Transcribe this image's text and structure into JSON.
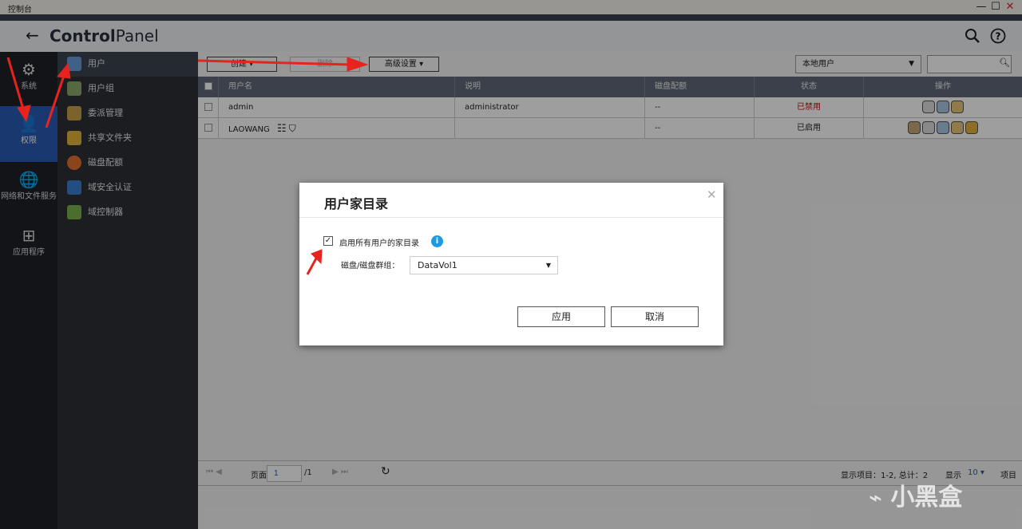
{
  "window": {
    "title": "控制台",
    "minimize": "—",
    "maximize": "☐",
    "close": "✕"
  },
  "header": {
    "back": "←",
    "title_bold": "Control",
    "title_rest": "Panel",
    "search_icon": "search-icon",
    "help_icon": "help-icon"
  },
  "iconnav": [
    {
      "label": "系统",
      "icon": "⚙"
    },
    {
      "label": "权限",
      "icon": "👤"
    },
    {
      "label": "网络和文件服务",
      "icon": "🌐"
    },
    {
      "label": "应用程序",
      "icon": "⊞"
    }
  ],
  "sidebar": [
    {
      "label": "用户",
      "color": "#6a9bd8"
    },
    {
      "label": "用户组",
      "color": "#8aa86a"
    },
    {
      "label": "委派管理",
      "color": "#c9a04a"
    },
    {
      "label": "共享文件夹",
      "color": "#e3b23c"
    },
    {
      "label": "磁盘配额",
      "color": "#e07030"
    },
    {
      "label": "域安全认证",
      "color": "#3b7fd0"
    },
    {
      "label": "域控制器",
      "color": "#7ab04a"
    }
  ],
  "toolbar": {
    "create": "创建",
    "delete": "删除",
    "advanced": "高级设置",
    "user_filter": "本地用户",
    "search_placeholder": ""
  },
  "table": {
    "columns": [
      "用户名",
      "说明",
      "磁盘配额",
      "状态",
      "操作"
    ],
    "rows": [
      {
        "name": "admin",
        "desc": "administrator",
        "quota": "--",
        "status": "已禁用",
        "status_color": "#cc0000"
      },
      {
        "name": "LAOWANG",
        "desc": "",
        "quota": "--",
        "status": "已启用",
        "status_color": "#222222"
      }
    ]
  },
  "footer": {
    "page_label": "页面",
    "page": "1",
    "total_pages": "/1",
    "items_info": "显示项目：1-2, 总计：2",
    "show_label": "显示",
    "per_page": "10",
    "items_label": "项目"
  },
  "dialog": {
    "title": "用户家目录",
    "checkbox_label": "启用所有用户的家目录",
    "checked": true,
    "volume_label": "磁盘/磁盘群组：",
    "volume_value": "DataVol1",
    "apply": "应用",
    "cancel": "取消"
  },
  "watermark": "小黑盒"
}
